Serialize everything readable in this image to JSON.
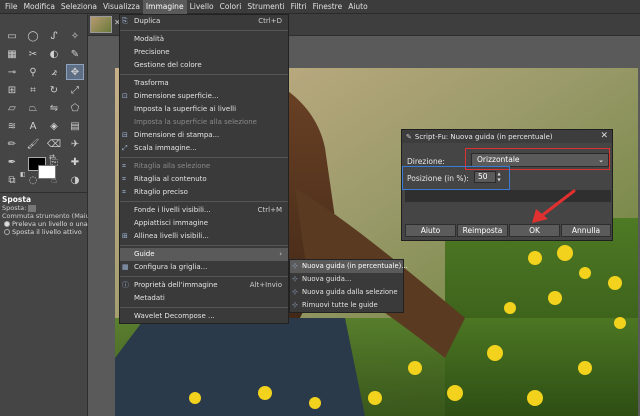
{
  "menubar": [
    {
      "label": "File"
    },
    {
      "label": "Modifica"
    },
    {
      "label": "Seleziona"
    },
    {
      "label": "Visualizza"
    },
    {
      "label": "Immagine",
      "active": true
    },
    {
      "label": "Livello"
    },
    {
      "label": "Colori"
    },
    {
      "label": "Strumenti"
    },
    {
      "label": "Filtri"
    },
    {
      "label": "Finestre"
    },
    {
      "label": "Aiuto"
    }
  ],
  "tools": [
    {
      "icon": "rect-select-icon",
      "glyph": "▭"
    },
    {
      "icon": "ellipse-select-icon",
      "glyph": "◯"
    },
    {
      "icon": "free-select-icon",
      "glyph": "ᔑ"
    },
    {
      "icon": "fuzzy-select-icon",
      "glyph": "✧"
    },
    {
      "icon": "select-by-color-icon",
      "glyph": "▦"
    },
    {
      "icon": "scissors-icon",
      "glyph": "✂"
    },
    {
      "icon": "foreground-select-icon",
      "glyph": "◐"
    },
    {
      "icon": "paths-icon",
      "glyph": "✎"
    },
    {
      "icon": "color-picker-icon",
      "glyph": "⊸"
    },
    {
      "icon": "zoom-icon",
      "glyph": "⚲"
    },
    {
      "icon": "measure-icon",
      "glyph": "⦨"
    },
    {
      "icon": "move-icon",
      "glyph": "✥",
      "selected": true
    },
    {
      "icon": "align-icon",
      "glyph": "⊞"
    },
    {
      "icon": "crop-icon",
      "glyph": "⌗"
    },
    {
      "icon": "rotate-icon",
      "glyph": "↻"
    },
    {
      "icon": "scale-icon",
      "glyph": "⤢"
    },
    {
      "icon": "shear-icon",
      "glyph": "▱"
    },
    {
      "icon": "perspective-icon",
      "glyph": "⏢"
    },
    {
      "icon": "flip-icon",
      "glyph": "⇋"
    },
    {
      "icon": "cage-icon",
      "glyph": "⬠"
    },
    {
      "icon": "warp-icon",
      "glyph": "≋"
    },
    {
      "icon": "text-icon",
      "glyph": "A"
    },
    {
      "icon": "bucket-fill-icon",
      "glyph": "◈"
    },
    {
      "icon": "gradient-icon",
      "glyph": "▤"
    },
    {
      "icon": "pencil-icon",
      "glyph": "✏"
    },
    {
      "icon": "paintbrush-icon",
      "glyph": "🖌"
    },
    {
      "icon": "eraser-icon",
      "glyph": "⌫"
    },
    {
      "icon": "airbrush-icon",
      "glyph": "✈"
    },
    {
      "icon": "ink-icon",
      "glyph": "✒"
    },
    {
      "icon": "mypaint-brush-icon",
      "glyph": "✐"
    },
    {
      "icon": "clone-icon",
      "glyph": "⎘"
    },
    {
      "icon": "heal-icon",
      "glyph": "✚"
    },
    {
      "icon": "perspective-clone-icon",
      "glyph": "⧉"
    },
    {
      "icon": "blur-icon",
      "glyph": "◌"
    },
    {
      "icon": "smudge-icon",
      "glyph": "☝"
    },
    {
      "icon": "dodge-burn-icon",
      "glyph": "◑"
    }
  ],
  "tool_options": {
    "title": "Sposta",
    "line1": "Sposta:",
    "line2": "Commuta strumento (Maiu",
    "radio1": "Preleva un livello o una",
    "radio2": "Sposta il livello attivo"
  },
  "image_menu": [
    {
      "label": "Duplica",
      "shortcut": "Ctrl+D",
      "icon": "⎘"
    },
    {
      "sep": true
    },
    {
      "label": "Modalità"
    },
    {
      "label": "Precisione"
    },
    {
      "label": "Gestione del colore"
    },
    {
      "sep": true
    },
    {
      "label": "Trasforma"
    },
    {
      "label": "Dimensione superficie...",
      "icon": "⊡"
    },
    {
      "label": "Imposta la superficie ai livelli"
    },
    {
      "label": "Imposta la superficie alla selezione",
      "disabled": true
    },
    {
      "label": "Dimensione di stampa...",
      "icon": "⊟"
    },
    {
      "label": "Scala immagine...",
      "icon": "⤢"
    },
    {
      "sep": true
    },
    {
      "label": "Ritaglia alla selezione",
      "disabled": true,
      "icon": "⌗"
    },
    {
      "label": "Ritaglia al contenuto",
      "icon": "⌗"
    },
    {
      "label": "Ritaglio preciso",
      "icon": "⌗"
    },
    {
      "sep": true
    },
    {
      "label": "Fonde i livelli visibili...",
      "shortcut": "Ctrl+M"
    },
    {
      "label": "Appiattisci immagine"
    },
    {
      "label": "Allinea livelli visibili...",
      "icon": "⊞"
    },
    {
      "sep": true
    },
    {
      "label": "Guide",
      "highlight": true,
      "submenu": true
    },
    {
      "label": "Configura la griglia...",
      "icon": "▦"
    },
    {
      "sep": true
    },
    {
      "label": "Proprietà dell'immagine",
      "shortcut": "Alt+Invio",
      "icon": "ⓘ"
    },
    {
      "label": "Metadati"
    },
    {
      "sep": true
    },
    {
      "label": "Wavelet Decompose ..."
    }
  ],
  "guide_submenu": [
    {
      "label": "Nuova guida (in percentuale)...",
      "highlight": true
    },
    {
      "label": "Nuova guida..."
    },
    {
      "label": "Nuova guida dalla selezione"
    },
    {
      "label": "Rimuovi tutte le guide"
    }
  ],
  "dialog": {
    "title": "Script-Fu: Nuova guida (in percentuale)",
    "direction_label": "Direzione:",
    "direction_value": "Orizzontale",
    "position_label": "Posizione (in %):",
    "position_value": "50",
    "help": "Aiuto",
    "reset": "Reimposta",
    "ok": "OK",
    "cancel": "Annulla"
  },
  "colors": {
    "accent_red": "#e03030",
    "accent_blue": "#3a7bd5"
  }
}
